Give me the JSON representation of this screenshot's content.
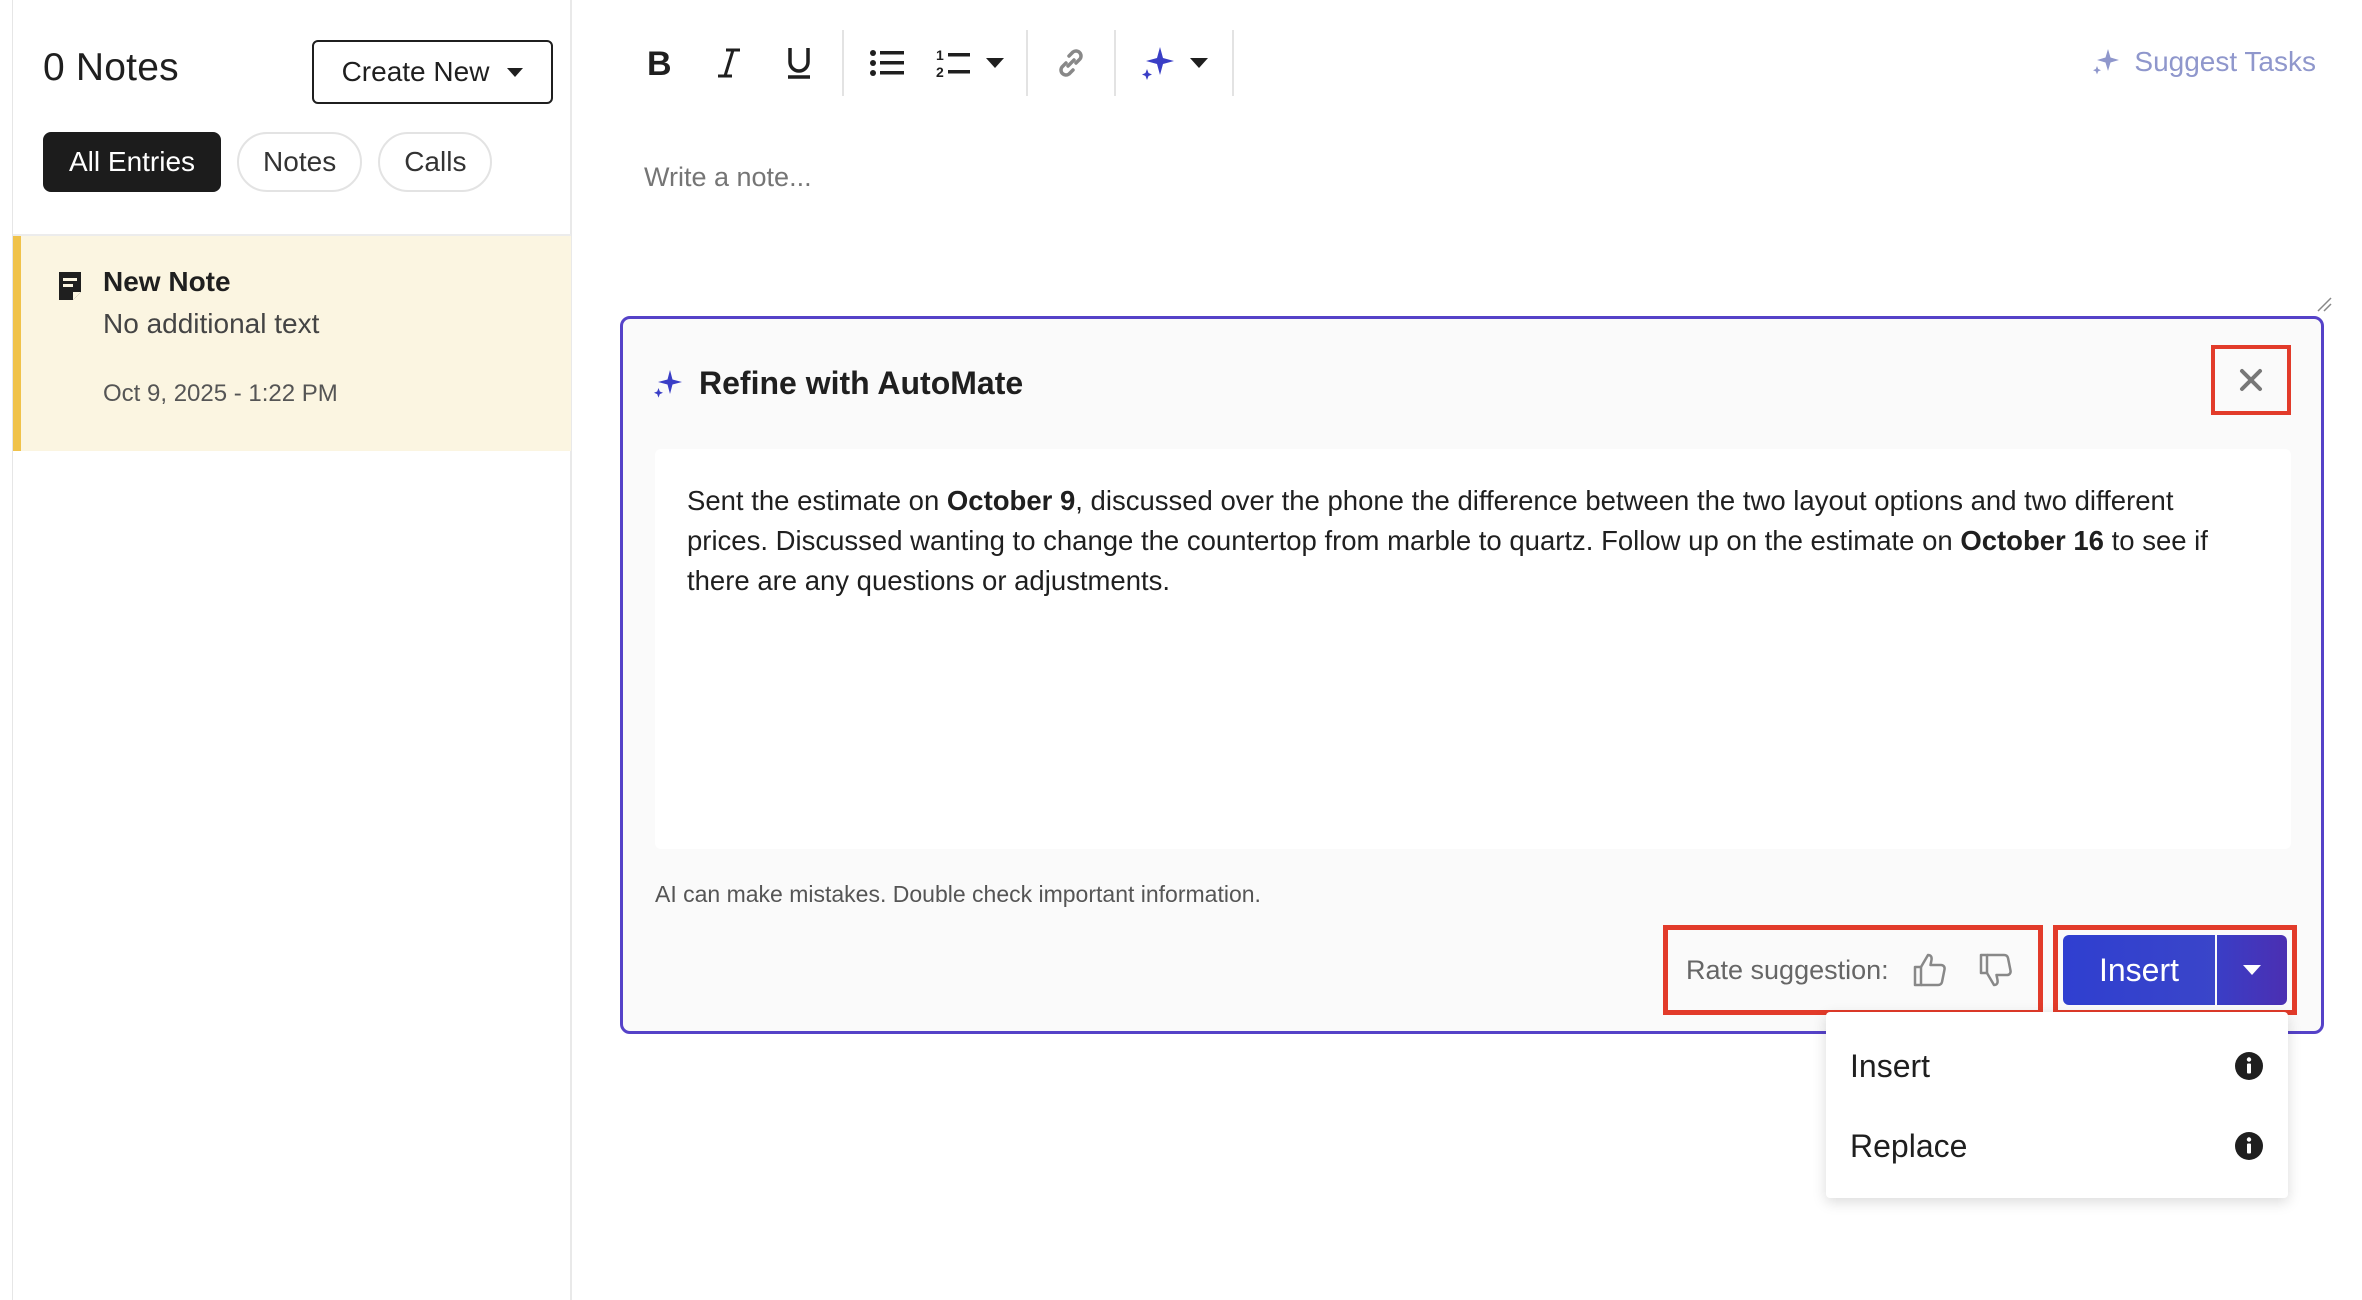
{
  "sidebar": {
    "notes_count": "0 Notes",
    "create_new_label": "Create New",
    "filters": [
      {
        "label": "All Entries",
        "active": true
      },
      {
        "label": "Notes",
        "active": false
      },
      {
        "label": "Calls",
        "active": false
      }
    ],
    "note": {
      "title": "New Note",
      "subtitle": "No additional text",
      "date": "Oct 9, 2025 - 1:22 PM"
    }
  },
  "toolbar": {
    "icons": [
      "bold-icon",
      "italic-icon",
      "underline-icon",
      "bulleted-list-icon",
      "numbered-list-icon",
      "link-icon",
      "sparkle-icon"
    ],
    "suggest_tasks_label": "Suggest Tasks"
  },
  "editor": {
    "placeholder": "Write a note..."
  },
  "refine_panel": {
    "title": "Refine with AutoMate",
    "content_parts": {
      "p1": "Sent the estimate on ",
      "b1": "October 9",
      "p2": ", discussed over the phone the difference between the two layout options and two different prices. Discussed wanting to change the countertop from marble to quartz. Follow up on the estimate on ",
      "b2": "October 16",
      "p3": " to see if there are any questions or adjustments."
    },
    "disclaimer": "AI can make mistakes. Double check important information.",
    "rate_label": "Rate suggestion:",
    "insert_label": "Insert"
  },
  "dropdown": {
    "items": [
      {
        "label": "Insert"
      },
      {
        "label": "Replace"
      }
    ]
  },
  "colors": {
    "accent": "#3a45c9",
    "highlight_border": "#e23b2a",
    "panel_border": "#5542c8",
    "note_bg": "#fbf5e1",
    "note_accent": "#f0c24a"
  }
}
